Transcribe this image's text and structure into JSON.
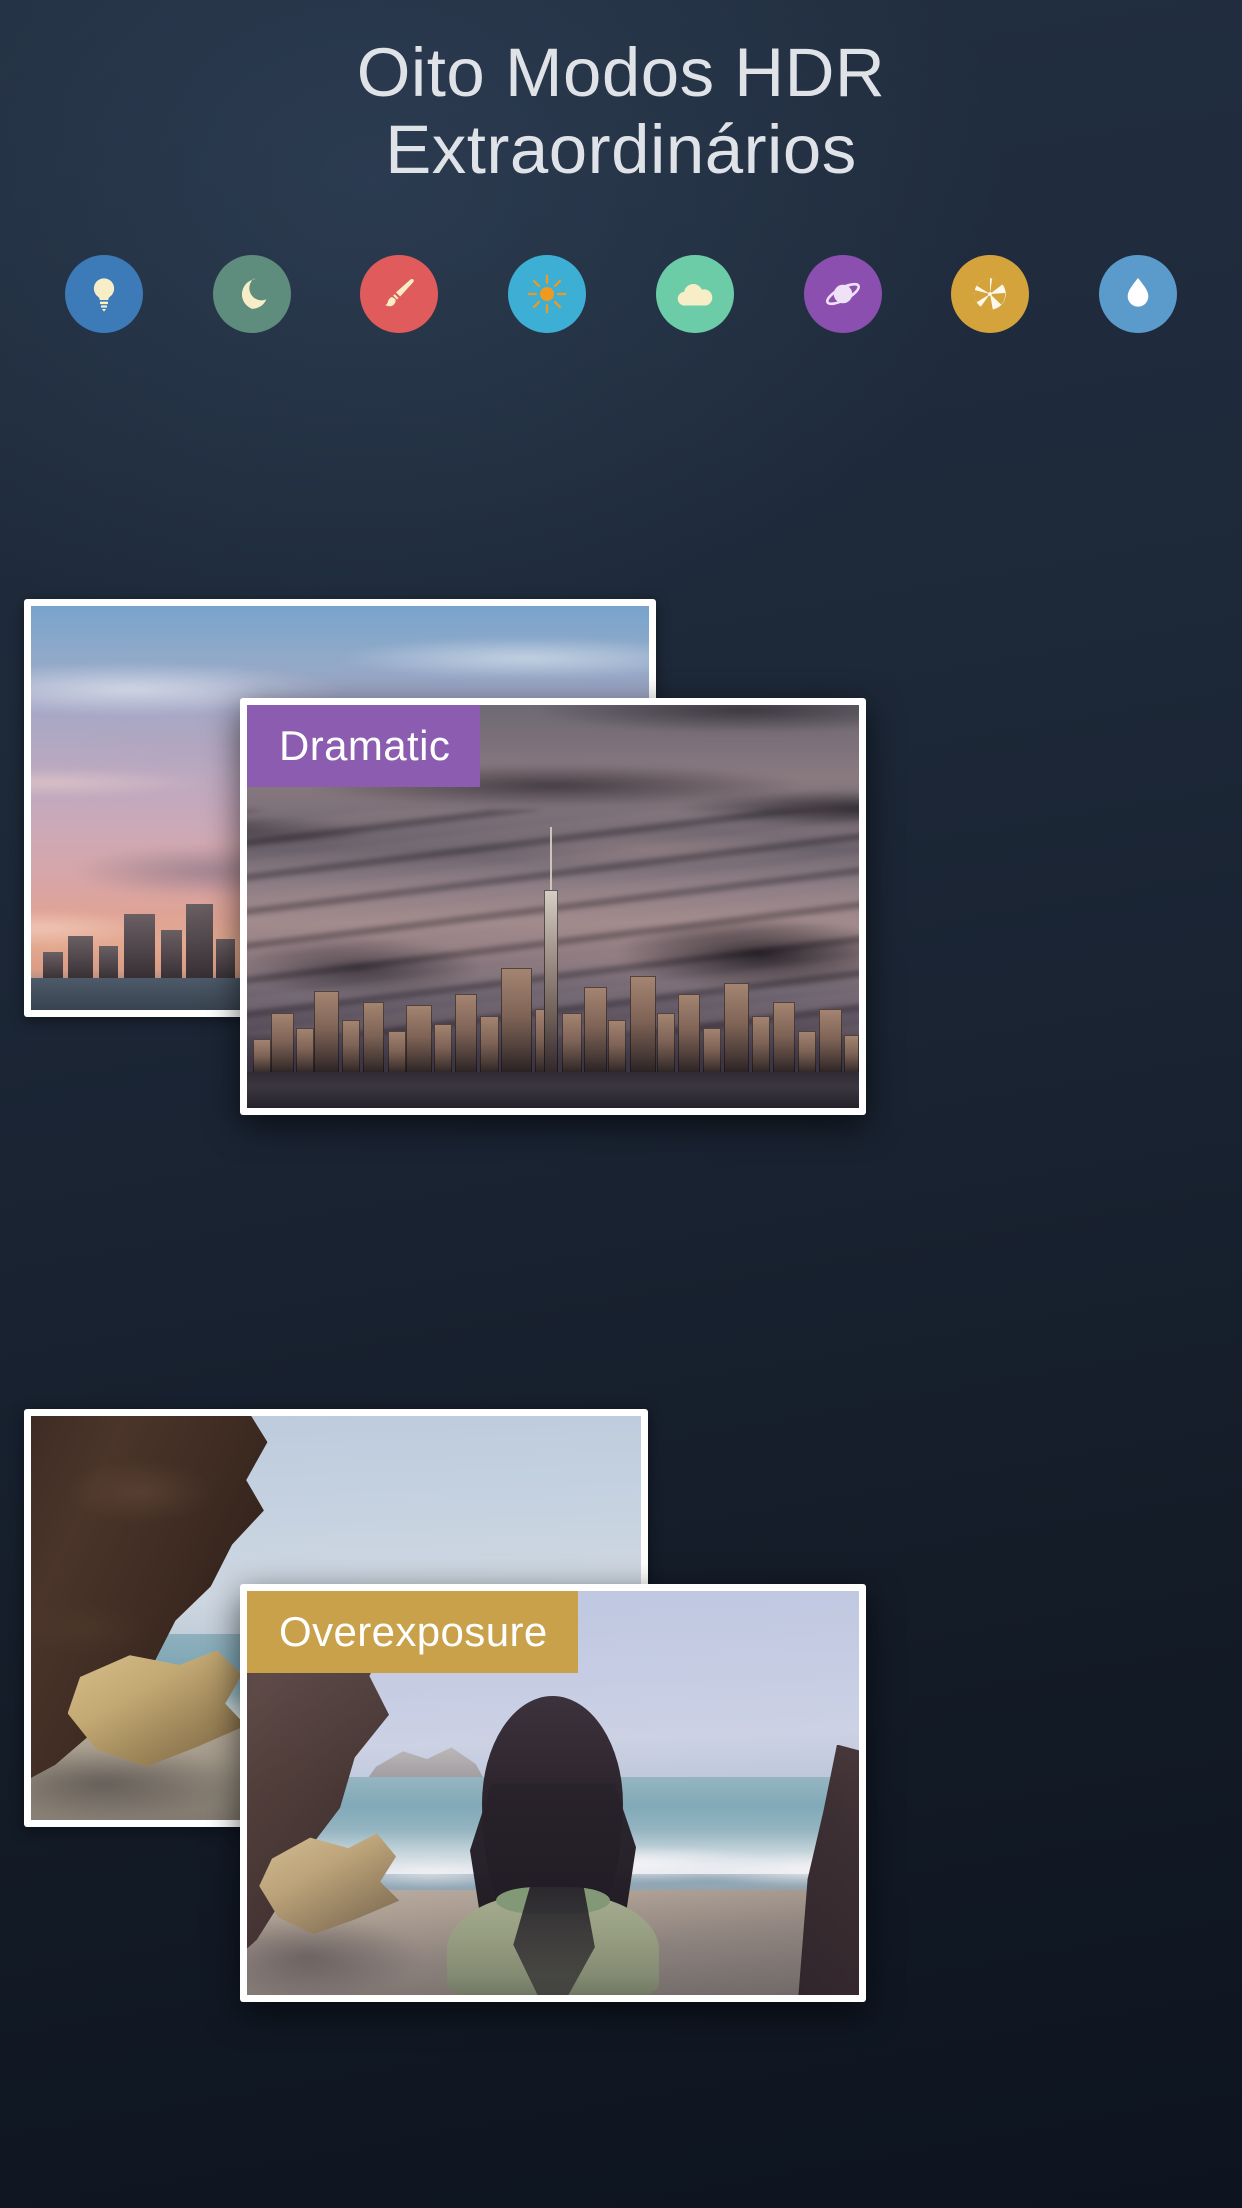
{
  "header": {
    "title_line1": "Oito Modos HDR",
    "title_line2": "Extraordinários",
    "title_color": "#dfe2e7"
  },
  "background": {
    "top_color": "#222f41",
    "bottom_color": "#0d1420"
  },
  "hdr_modes": [
    {
      "name": "lightbulb",
      "icon": "lightbulb-icon",
      "circle_color": "#3d7ab8",
      "glyph_color": "#f7eec8"
    },
    {
      "name": "moon",
      "icon": "moon-icon",
      "circle_color": "#5e8c7d",
      "glyph_color": "#f7eec8"
    },
    {
      "name": "paintbrush",
      "icon": "paintbrush-icon",
      "circle_color": "#e05c5c",
      "glyph_color": "#f7eec8"
    },
    {
      "name": "sun",
      "icon": "sun-icon",
      "circle_color": "#3dafd4",
      "glyph_color": "#f0991f"
    },
    {
      "name": "cloud",
      "icon": "cloud-icon",
      "circle_color": "#6dcca8",
      "glyph_color": "#f7eec8"
    },
    {
      "name": "planet",
      "icon": "planet-icon",
      "circle_color": "#8b4fb0",
      "glyph_color": "#efe2f7"
    },
    {
      "name": "aperture",
      "icon": "aperture-icon",
      "circle_color": "#d4a33c",
      "glyph_color": "#fdf8ec"
    },
    {
      "name": "waterdrop",
      "icon": "water-drop-icon",
      "circle_color": "#5a9bcb",
      "glyph_color": "#ffffff"
    }
  ],
  "showcase": [
    {
      "id": "dramatic",
      "label": "Dramatic",
      "label_color": "#8b5cb0",
      "back_photo_alt": "Sunset city skyline with pink and purple clouds",
      "front_photo_alt": "HDR Manhattan skyline under dark storm clouds"
    },
    {
      "id": "overexposure",
      "label": "Overexposure",
      "label_color": "#c9a14a",
      "back_photo_alt": "Rocky sea cove with sandy beach",
      "front_photo_alt": "Woman with long dark hair facing the ocean on the beach"
    }
  ]
}
